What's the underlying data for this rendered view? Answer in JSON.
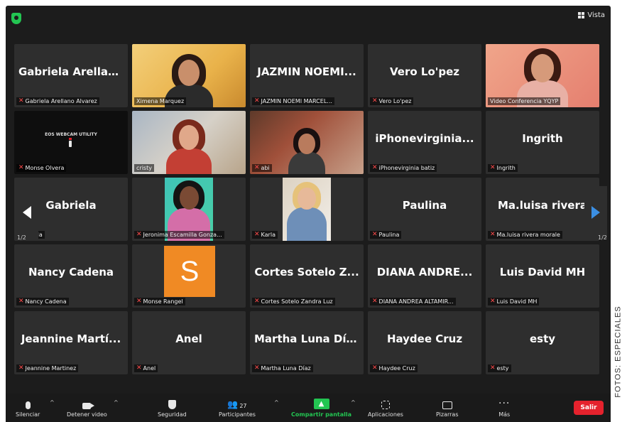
{
  "window": {
    "view_button_label": "Vista",
    "page_indicator_left": "1/2",
    "page_indicator_right": "1/2"
  },
  "side_credit": "FOTOS: ESPECIALES",
  "colors": {
    "accent_green": "#23c552",
    "leave_red": "#e5222d",
    "highlight_border": "#d8e24a",
    "tile_bg": "#2e2e2e",
    "muted_mic": "#ff4b4b"
  },
  "tiles": [
    {
      "display_name": "Gabriela  Arellan...",
      "label": "Gabriela Arellano Alvarez",
      "muted": true,
      "video": false
    },
    {
      "display_name": "",
      "label": "Ximena Marquez",
      "muted": false,
      "video": true
    },
    {
      "display_name": "JAZMIN  NOEMI...",
      "label": "JAZMIN NOEMI MARCEL...",
      "muted": true,
      "video": false
    },
    {
      "display_name": "Vero Lo'pez",
      "label": "Vero Lo'pez",
      "muted": true,
      "video": false
    },
    {
      "display_name": "",
      "label": "Video Conferencia YQYP",
      "muted": false,
      "video": true,
      "highlight": true
    },
    {
      "display_name": "",
      "label": "Monse Olvera",
      "muted": true,
      "video": true,
      "screen_text": "EOS WEBCAM UTILITY"
    },
    {
      "display_name": "",
      "label": "cristy",
      "muted": false,
      "video": true
    },
    {
      "display_name": "",
      "label": "abi",
      "muted": true,
      "video": true
    },
    {
      "display_name": "iPhonevirginia...",
      "label": "iPhonevirginia batiz",
      "muted": true,
      "video": false
    },
    {
      "display_name": "Ingrith",
      "label": "Ingrith",
      "muted": true,
      "video": false
    },
    {
      "display_name": "Gabriela",
      "label": "Gabriela",
      "muted": false,
      "video": false
    },
    {
      "display_name": "",
      "label": "Jeronima Escamilla Gonza...",
      "muted": true,
      "video": true
    },
    {
      "display_name": "",
      "label": "Karla",
      "muted": true,
      "video": true
    },
    {
      "display_name": "Paulina",
      "label": "Paulina",
      "muted": true,
      "video": false
    },
    {
      "display_name": "Ma.luisa  rivera",
      "label": "Ma.luisa rivera morale",
      "muted": true,
      "video": false
    },
    {
      "display_name": "Nancy Cadena",
      "label": "Nancy Cadena",
      "muted": true,
      "video": false
    },
    {
      "display_name": "",
      "label": "Monse Rangel",
      "muted": true,
      "video": false,
      "avatar_letter": "S"
    },
    {
      "display_name": "Cortes Sotelo Z...",
      "label": "Cortes Sotelo Zandra Luz",
      "muted": true,
      "video": false
    },
    {
      "display_name": "DIANA  ANDRE...",
      "label": "DIANA ANDREA ALTAMIR...",
      "muted": true,
      "video": false
    },
    {
      "display_name": "Luis David MH",
      "label": "Luis David MH",
      "muted": true,
      "video": false
    },
    {
      "display_name": "Jeannine  Martí...",
      "label": "Jeannine Martinez",
      "muted": true,
      "video": false
    },
    {
      "display_name": "Anel",
      "label": "Anel",
      "muted": true,
      "video": false
    },
    {
      "display_name": "Martha Luna Díaz",
      "label": "Martha Luna Díaz",
      "muted": true,
      "video": false
    },
    {
      "display_name": "Haydee Cruz",
      "label": "Haydee Cruz",
      "muted": true,
      "video": false
    },
    {
      "display_name": "esty",
      "label": "esty",
      "muted": true,
      "video": false
    }
  ],
  "toolbar": {
    "mute_label": "Silenciar",
    "video_label": "Detener video",
    "security_label": "Seguridad",
    "participants_label": "Participantes",
    "participants_count": "27",
    "share_label": "Compartir pantalla",
    "apps_label": "Aplicaciones",
    "whiteboards_label": "Pizarras",
    "more_label": "Más",
    "leave_label": "Salir"
  }
}
